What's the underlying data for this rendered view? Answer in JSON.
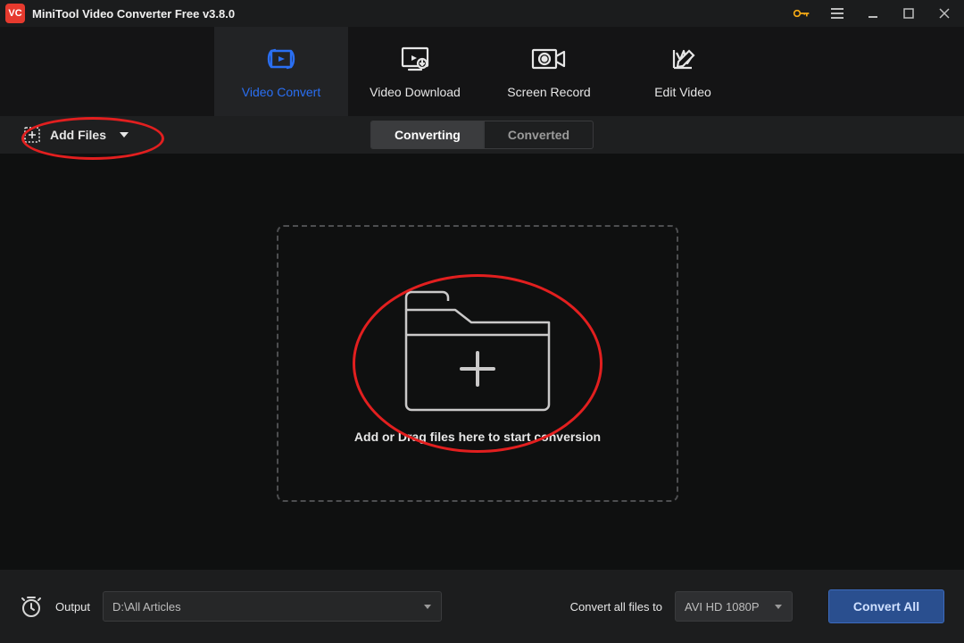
{
  "titlebar": {
    "title": "MiniTool Video Converter Free v3.8.0"
  },
  "maintabs": {
    "items": [
      {
        "label": "Video Convert"
      },
      {
        "label": "Video Download"
      },
      {
        "label": "Screen Record"
      },
      {
        "label": "Edit Video"
      }
    ]
  },
  "subbar": {
    "addfiles_label": "Add Files",
    "seg_converting": "Converting",
    "seg_converted": "Converted"
  },
  "dropzone": {
    "text": "Add or Drag files here to start conversion"
  },
  "footer": {
    "output_label": "Output",
    "output_path": "D:\\All Articles",
    "convert_label": "Convert all files to",
    "format_value": "AVI HD 1080P",
    "convert_button": "Convert All"
  }
}
